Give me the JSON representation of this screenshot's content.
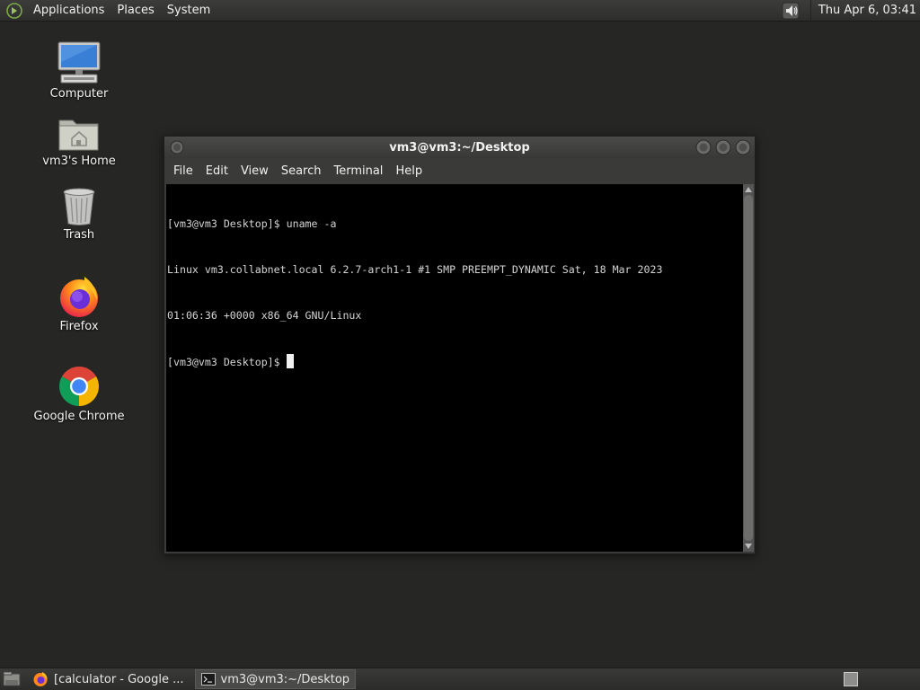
{
  "top_panel": {
    "menus": [
      "Applications",
      "Places",
      "System"
    ],
    "clock": "Thu Apr  6, 03:41"
  },
  "desktop_icons": [
    {
      "label": "Computer",
      "icon": "computer-icon"
    },
    {
      "label": "vm3's Home",
      "icon": "home-folder-icon"
    },
    {
      "label": "Trash",
      "icon": "trash-icon"
    },
    {
      "label": "Firefox",
      "icon": "firefox-icon"
    },
    {
      "label": "Google Chrome",
      "icon": "chrome-icon"
    }
  ],
  "terminal": {
    "title": "vm3@vm3:~/Desktop",
    "menu": [
      "File",
      "Edit",
      "View",
      "Search",
      "Terminal",
      "Help"
    ],
    "lines": [
      "[vm3@vm3 Desktop]$ uname -a",
      "Linux vm3.collabnet.local 6.2.7-arch1-1 #1 SMP PREEMPT_DYNAMIC Sat, 18 Mar 2023",
      "01:06:36 +0000 x86_64 GNU/Linux"
    ],
    "prompt": "[vm3@vm3 Desktop]$ "
  },
  "taskbar": {
    "tasks": [
      {
        "label": "[calculator - Google ...",
        "icon": "firefox-icon",
        "active": false
      },
      {
        "label": "vm3@vm3:~/Desktop",
        "icon": "terminal-icon",
        "active": true
      }
    ]
  },
  "colors": {
    "desktop_bg": "#262725",
    "panel_bg": "#333432",
    "terminal_bg": "#000000",
    "terminal_fg": "#d4d4d4"
  }
}
